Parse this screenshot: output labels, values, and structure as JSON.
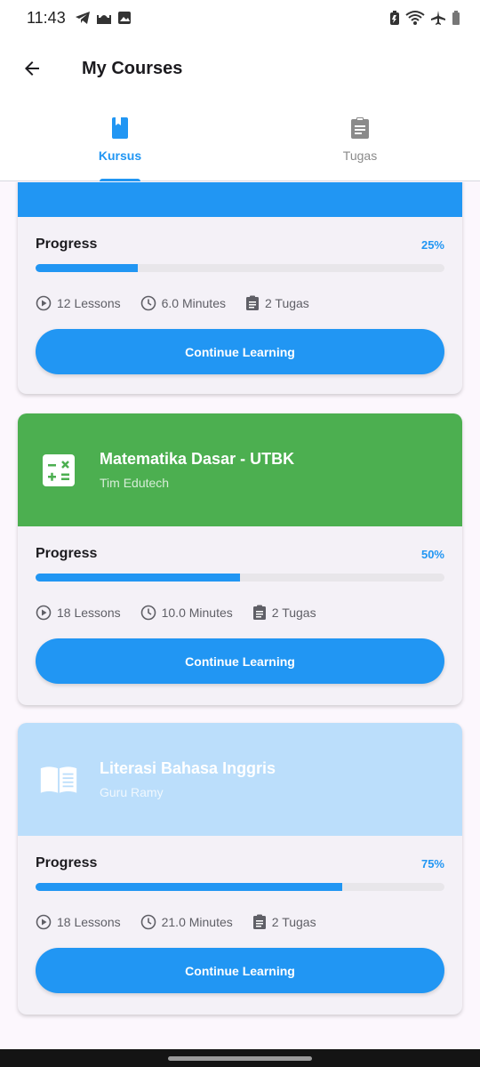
{
  "status_bar": {
    "time": "11:43"
  },
  "app_bar": {
    "title": "My Courses"
  },
  "tabs": [
    {
      "label": "Kursus",
      "icon": "book-icon",
      "active": true
    },
    {
      "label": "Tugas",
      "icon": "clipboard-icon",
      "active": false
    }
  ],
  "colors": {
    "primary": "#2196f3",
    "green": "#4caf50",
    "light_blue": "#bbdefb"
  },
  "courses": [
    {
      "title": "",
      "author": "",
      "header_color": "#2196f3",
      "progress_label": "Progress",
      "progress_percent": "25%",
      "progress_value": 0.25,
      "lessons": "12 Lessons",
      "duration": "6.0 Minutes",
      "tasks": "2 Tugas",
      "button": "Continue Learning"
    },
    {
      "title": "Matematika Dasar - UTBK",
      "author": "Tim Edutech",
      "header_color": "#4caf50",
      "icon": "calculator-icon",
      "progress_label": "Progress",
      "progress_percent": "50%",
      "progress_value": 0.5,
      "lessons": "18 Lessons",
      "duration": "10.0 Minutes",
      "tasks": "2 Tugas",
      "button": "Continue Learning"
    },
    {
      "title": "Literasi Bahasa Inggris",
      "author": "Guru Ramy",
      "header_color": "#bbdefb",
      "icon": "open-book-icon",
      "progress_label": "Progress",
      "progress_percent": "75%",
      "progress_value": 0.75,
      "lessons": "18 Lessons",
      "duration": "21.0 Minutes",
      "tasks": "2 Tugas",
      "button": "Continue Learning"
    }
  ]
}
